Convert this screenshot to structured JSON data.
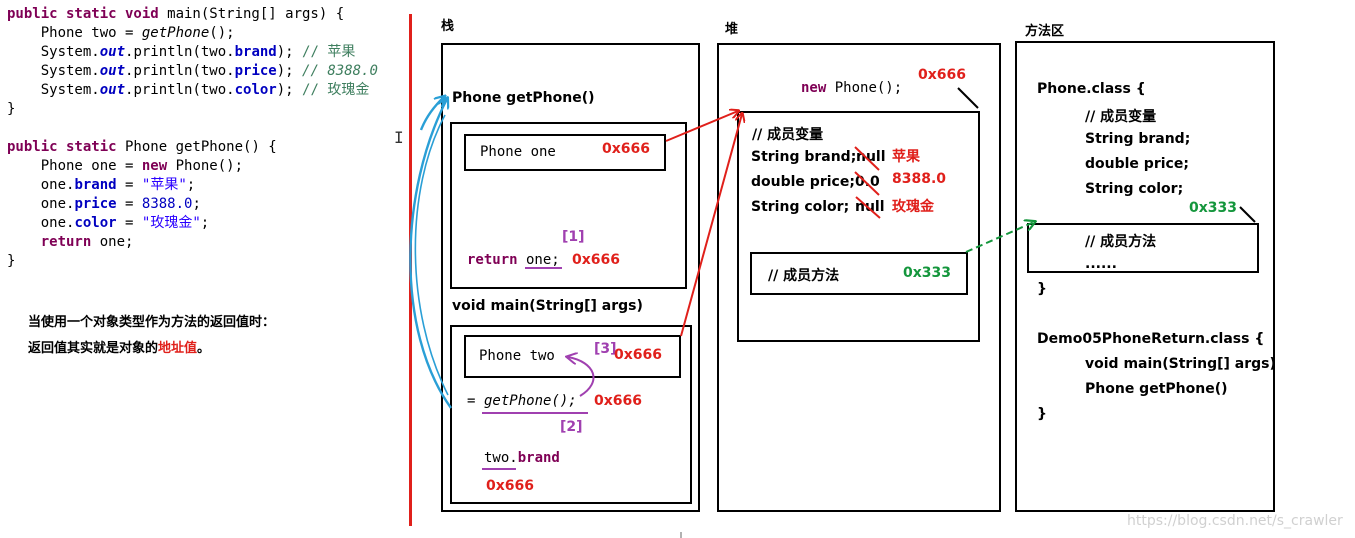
{
  "code": {
    "lines": [
      [
        "public static void",
        " main(String[] args) {"
      ],
      [
        "    Phone two = ",
        "getPhone",
        "();"
      ],
      [
        "    System.",
        "out",
        ".println(two.",
        "brand",
        "); ",
        "// 苹果"
      ],
      [
        "    System.",
        "out",
        ".println(two.",
        "price",
        "); ",
        "// 8388.0"
      ],
      [
        "    System.",
        "out",
        ".println(two.",
        "color",
        "); ",
        "// 玫瑰金"
      ],
      [
        "}"
      ],
      [
        "public static",
        " Phone getPhone() {"
      ],
      [
        "    Phone one = ",
        "new",
        " Phone();"
      ],
      [
        "    one.",
        "brand",
        " = ",
        "\"苹果\"",
        ";"
      ],
      [
        "    one.",
        "price",
        " = ",
        "8388.0",
        ";"
      ],
      [
        "    one.",
        "color",
        " = ",
        "\"玫瑰金\"",
        ";"
      ],
      [
        "    ",
        "return",
        " one;"
      ],
      [
        "}"
      ]
    ]
  },
  "note": {
    "line1": "当使用一个对象类型作为方法的返回值时：",
    "line2_prefix": "返回值其实就是对象的",
    "line2_highlight": "地址值",
    "line2_suffix": "。"
  },
  "stack": {
    "title": "栈",
    "getphone_frame": "Phone getPhone()",
    "phone_one": "Phone  one",
    "phone_one_addr": "0x666",
    "step1": "[1]",
    "return_kw": "return",
    "return_rest": " one;",
    "return_addr": "0x666",
    "main_frame": "void main(String[] args)",
    "phone_two": "Phone  two",
    "step3": "[3]",
    "phone_two_addr": "0x666",
    "assign_eq": "=",
    "assign_call": "getPhone();",
    "assign_addr": "0x666",
    "step2": "[2]",
    "two_brand_prefix": "two.",
    "two_brand_field": "brand",
    "two_brand_addr": "0x666"
  },
  "heap": {
    "title": "堆",
    "new_kw": "new",
    "new_rest": " Phone();",
    "new_addr": "0x666",
    "members_comment": "// 成员变量",
    "brand_decl": "String brand;",
    "brand_old": "null",
    "brand_new": "苹果",
    "price_decl": "double price;",
    "price_old": "0.0",
    "price_new": "8388.0",
    "color_decl": "String color;",
    "color_old": "null",
    "color_new": "玫瑰金",
    "methods_comment": "// 成员方法",
    "methods_addr": "0x333"
  },
  "method_area": {
    "title": "方法区",
    "phone_class": "Phone.class {",
    "members_comment": "// 成员变量",
    "brand": "String brand;",
    "price": "double price;",
    "color": "String color;",
    "methods_addr": "0x333",
    "methods_comment": "// 成员方法",
    "ellipsis": "......",
    "close1": "}",
    "demo_class": "Demo05PhoneReturn.class {",
    "main_sig": "void main(String[] args)",
    "getphone_sig": "Phone getPhone()",
    "close2": "}"
  },
  "watermark": "https://blog.csdn.net/s_crawler",
  "colors": {
    "red": "#e0201b",
    "green": "#14963c",
    "blue": "#2a9fd6",
    "purple": "#a040b0"
  }
}
